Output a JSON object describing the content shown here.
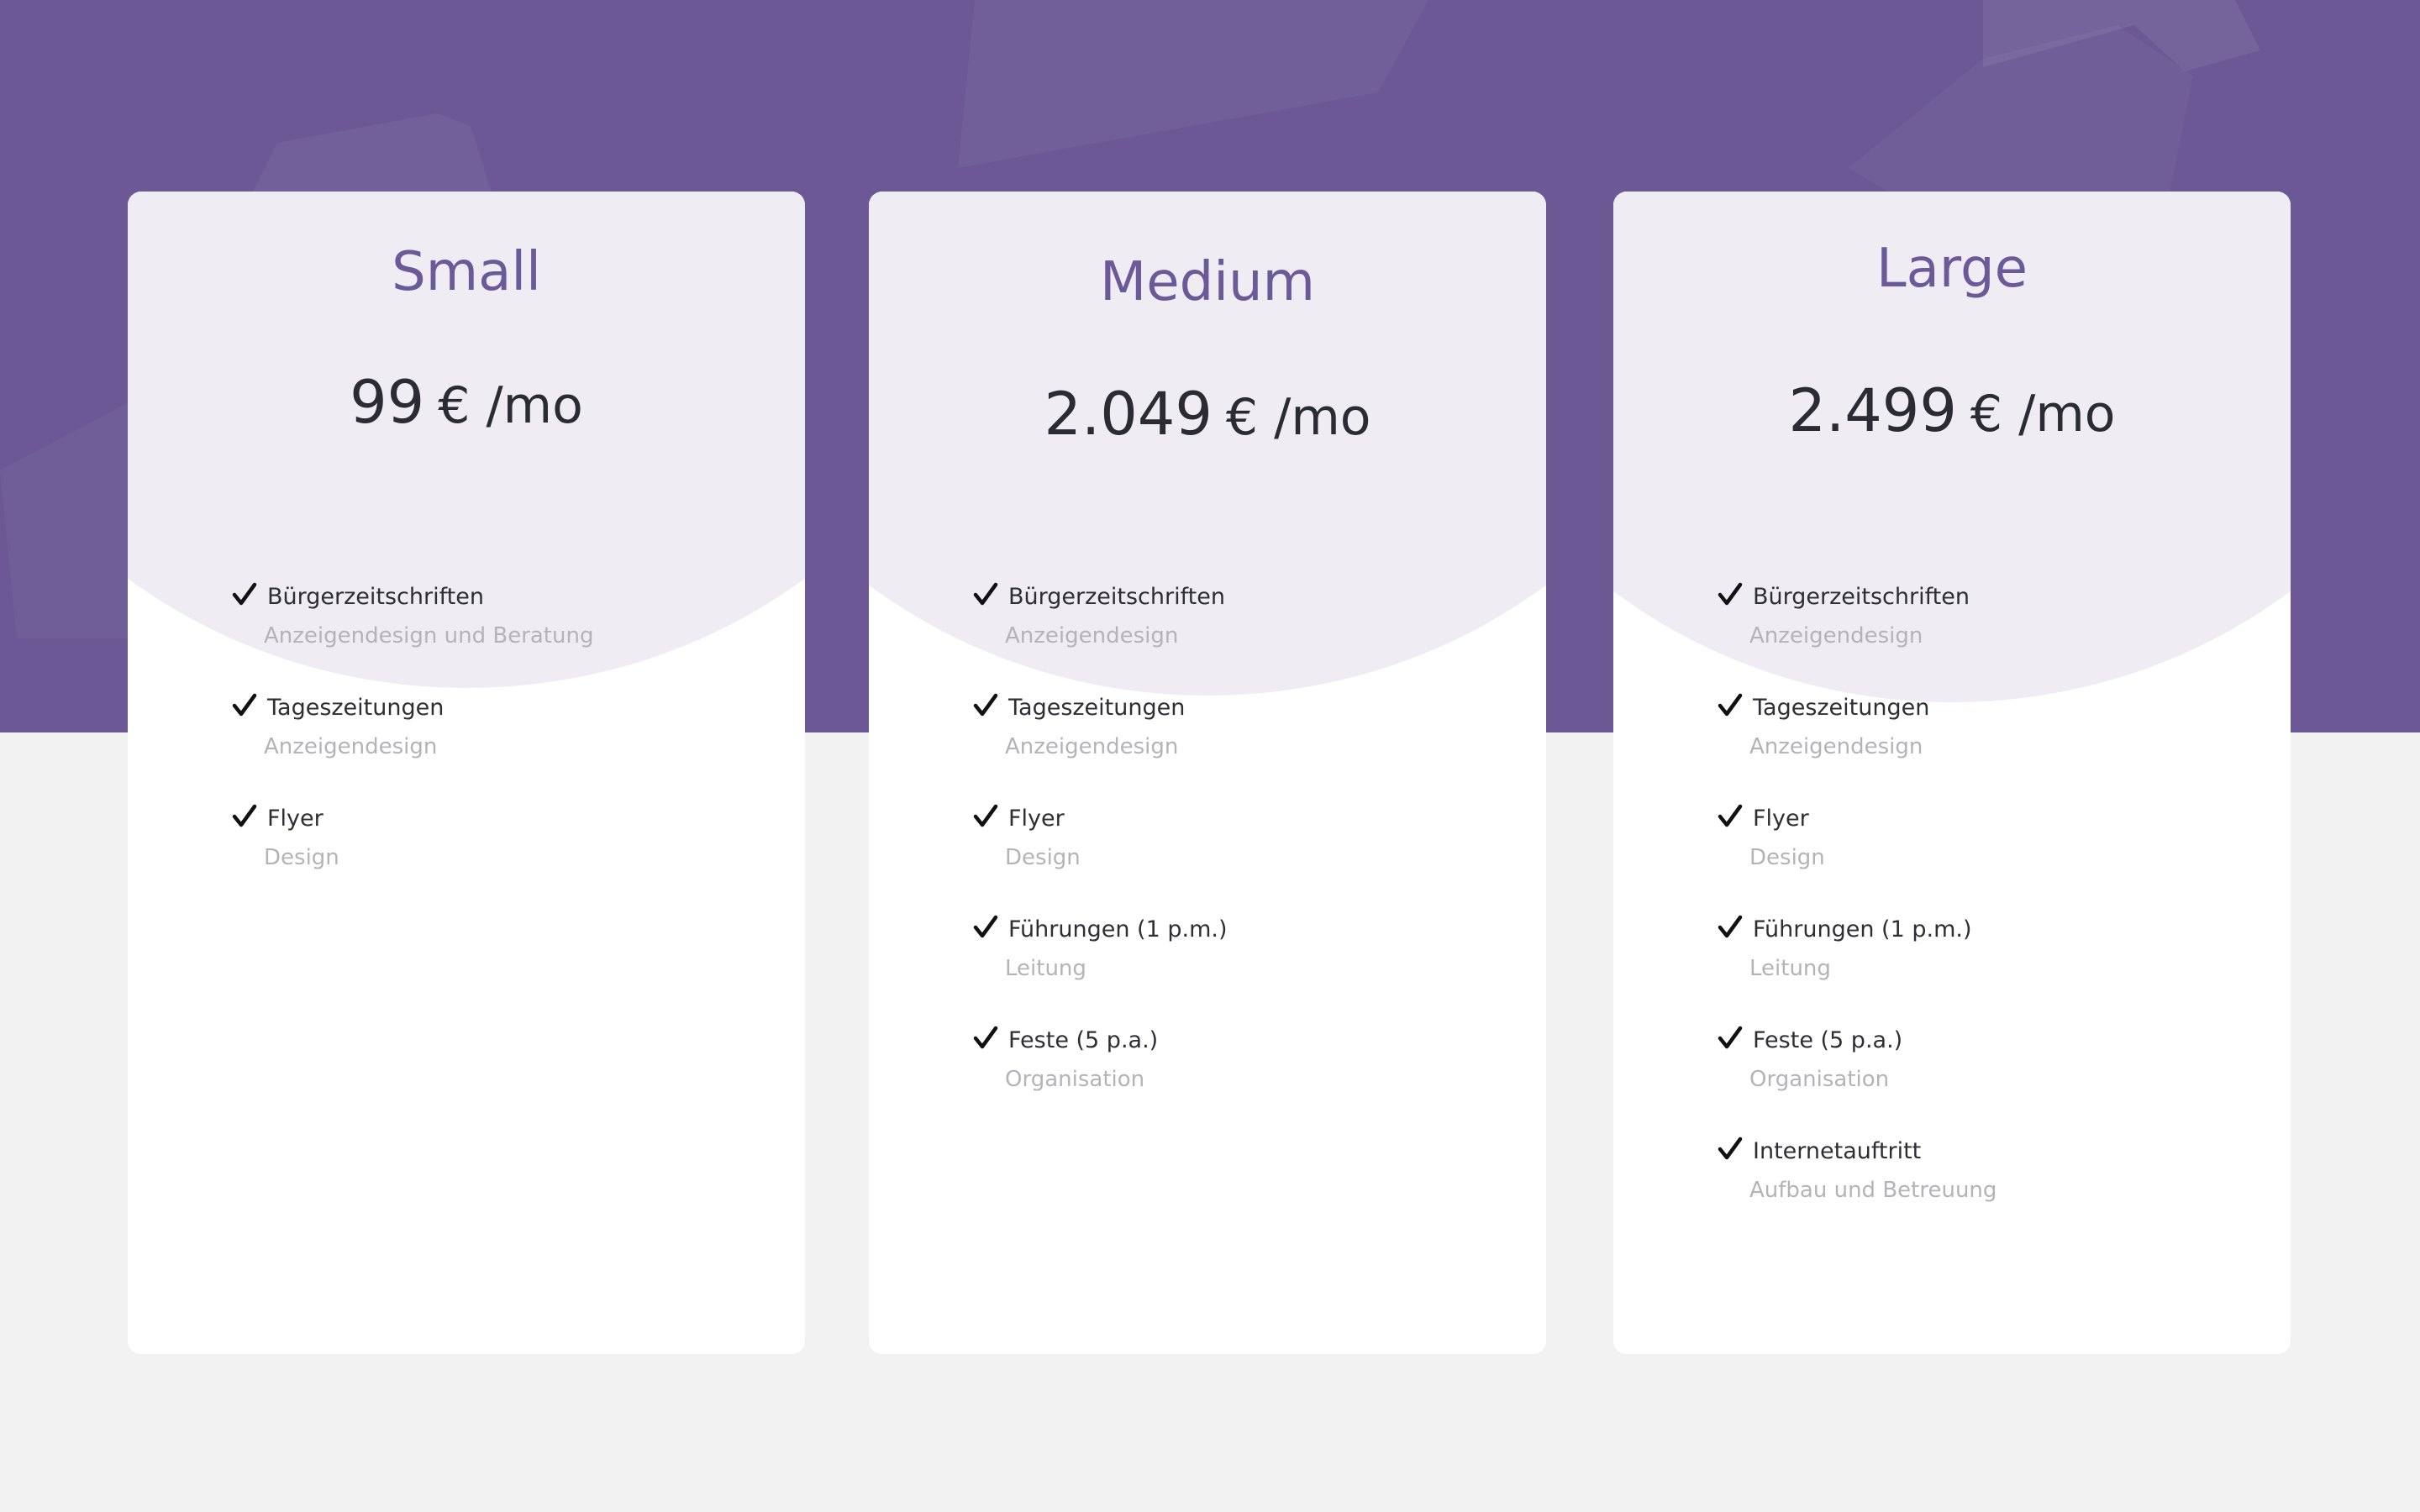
{
  "plans": [
    {
      "name": "Small",
      "price_amount": "99",
      "price_unit": "€ /mo",
      "features": [
        {
          "title": "Bürgerzeitschriften",
          "subtitle": "Anzeigendesign und Beratung"
        },
        {
          "title": "Tageszeitungen",
          "subtitle": "Anzeigendesign"
        },
        {
          "title": "Flyer",
          "subtitle": "Design"
        }
      ]
    },
    {
      "name": "Medium",
      "price_amount": "2.049",
      "price_unit": "€ /mo",
      "features": [
        {
          "title": "Bürgerzeitschriften",
          "subtitle": "Anzeigendesign"
        },
        {
          "title": "Tageszeitungen",
          "subtitle": "Anzeigendesign"
        },
        {
          "title": "Flyer",
          "subtitle": "Design"
        },
        {
          "title": "Führungen (1 p.m.)",
          "subtitle": "Leitung"
        },
        {
          "title": "Feste (5 p.a.)",
          "subtitle": "Organisation"
        }
      ]
    },
    {
      "name": "Large",
      "price_amount": "2.499",
      "price_unit": "€ /mo",
      "features": [
        {
          "title": "Bürgerzeitschriften",
          "subtitle": "Anzeigendesign"
        },
        {
          "title": "Tageszeitungen",
          "subtitle": "Anzeigendesign"
        },
        {
          "title": "Flyer",
          "subtitle": "Design"
        },
        {
          "title": "Führungen (1 p.m.)",
          "subtitle": "Leitung"
        },
        {
          "title": "Feste (5 p.a.)",
          "subtitle": "Organisation"
        },
        {
          "title": "Internetauftritt",
          "subtitle": "Aufbau und Betreuung"
        }
      ]
    }
  ],
  "colors": {
    "hero_background": "#6b5895",
    "page_background": "#f2f2f2",
    "tier_name": "#6a5a98",
    "card_header": "#efecf4"
  },
  "icons": {
    "feature_marker": "check-icon"
  }
}
